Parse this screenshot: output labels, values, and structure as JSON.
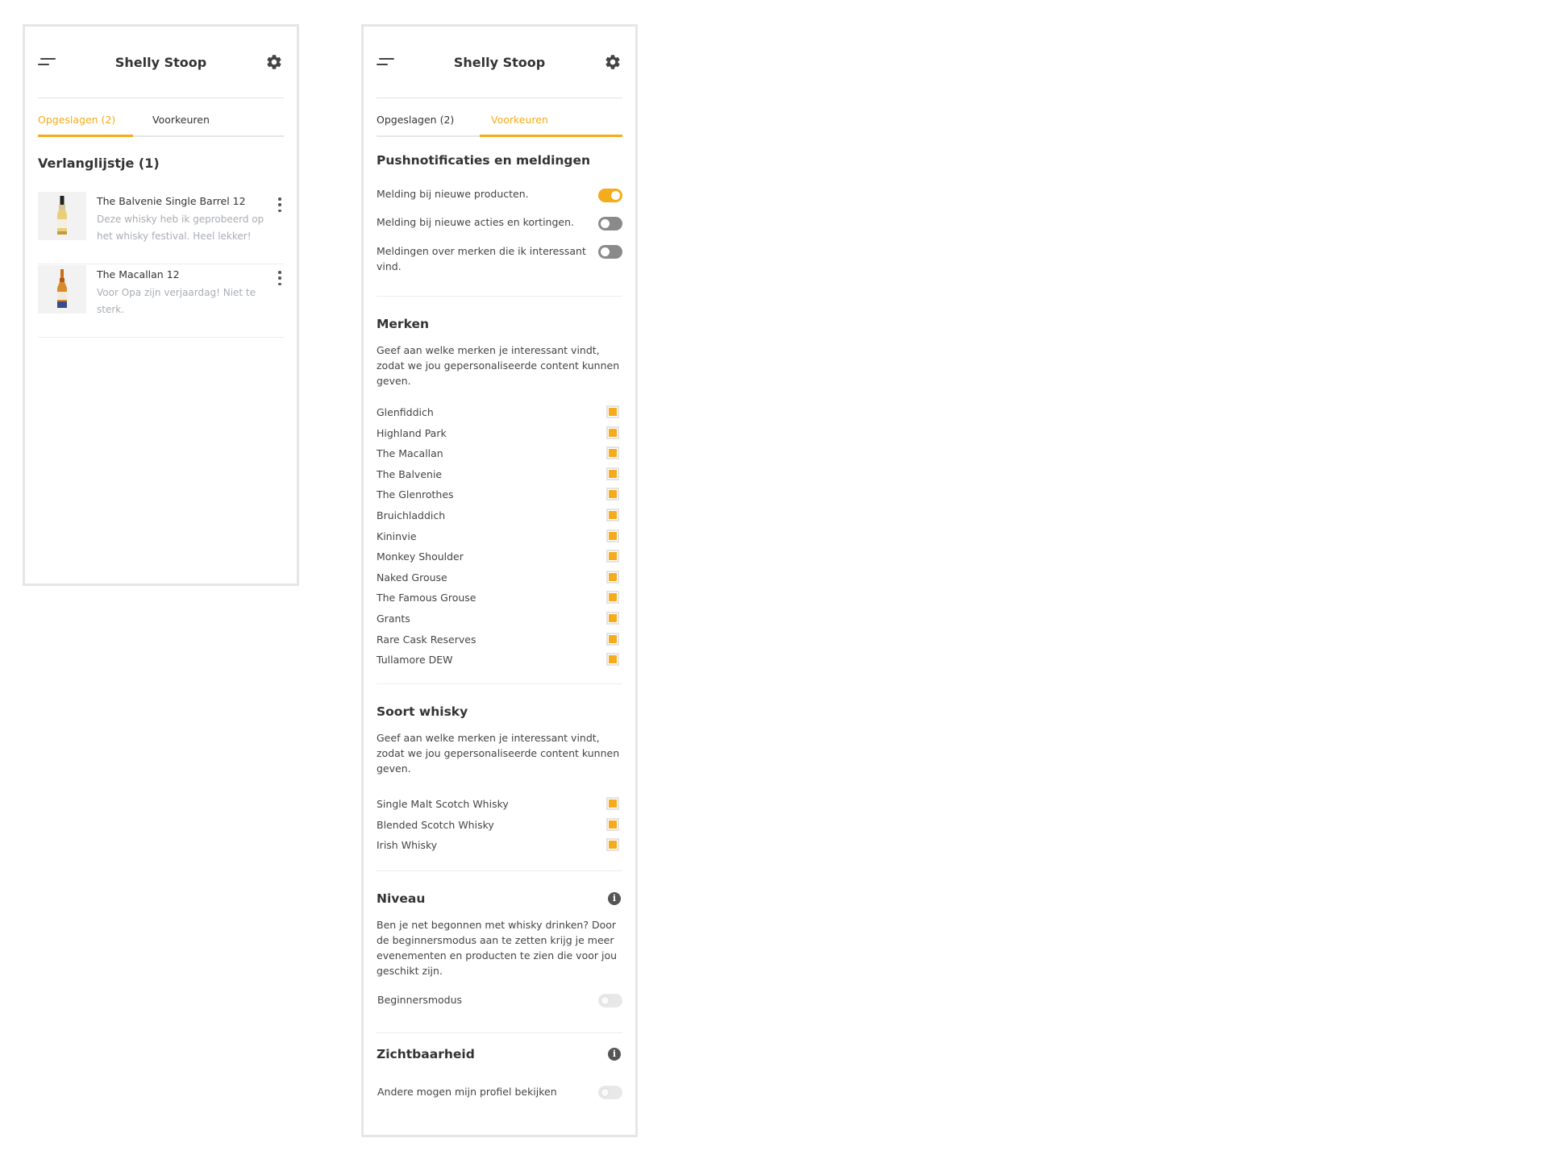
{
  "left": {
    "header": {
      "title": "Shelly Stoop",
      "menu_icon": "menu-icon",
      "settings_icon": "gear-icon"
    },
    "tabs": [
      {
        "label": "Opgeslagen (2)",
        "active": true
      },
      {
        "label": "Voorkeuren",
        "active": false
      }
    ],
    "wishlist": {
      "title": "Verlanglijstje (1)",
      "items": [
        {
          "name": "The Balvenie Single Barrel 12",
          "note": "Deze whisky heb ik geprobeerd op het whisky festival. Heel lekker!"
        },
        {
          "name": "The Macallan 12",
          "note": "Voor Opa zijn verjaardag! Niet te sterk."
        }
      ]
    }
  },
  "right": {
    "header": {
      "title": "Shelly Stoop",
      "menu_icon": "menu-icon",
      "settings_icon": "gear-icon"
    },
    "tabs": [
      {
        "label": "Opgeslagen (2)",
        "active": false
      },
      {
        "label": "Voorkeuren",
        "active": true
      }
    ],
    "notifications": {
      "title": "Pushnotificaties en meldingen",
      "rows": [
        {
          "label": "Melding bij nieuwe producten.",
          "state": "on"
        },
        {
          "label": "Melding bij nieuwe acties en kortingen.",
          "state": "off"
        },
        {
          "label": "Meldingen over merken die ik interessant vind.",
          "state": "off"
        }
      ]
    },
    "brands": {
      "title": "Merken",
      "description": "Geef aan welke merken je interessant vindt, zodat we jou gepersonaliseerde content kunnen geven.",
      "items": [
        {
          "label": "Glenfiddich",
          "checked": true
        },
        {
          "label": "Highland Park",
          "checked": true
        },
        {
          "label": "The Macallan",
          "checked": true
        },
        {
          "label": "The Balvenie",
          "checked": true
        },
        {
          "label": "The Glenrothes",
          "checked": true
        },
        {
          "label": "Bruichladdich",
          "checked": true
        },
        {
          "label": "Kininvie",
          "checked": true
        },
        {
          "label": "Monkey Shoulder",
          "checked": true
        },
        {
          "label": "Naked Grouse",
          "checked": true
        },
        {
          "label": "The Famous Grouse",
          "checked": true
        },
        {
          "label": "Grants",
          "checked": true
        },
        {
          "label": "Rare Cask Reserves",
          "checked": true
        },
        {
          "label": "Tullamore DEW",
          "checked": true
        }
      ]
    },
    "types": {
      "title": "Soort whisky",
      "description": "Geef aan welke merken je interessant vindt, zodat we jou gepersonaliseerde content kunnen geven.",
      "items": [
        {
          "label": "Single Malt Scotch Whisky",
          "checked": true
        },
        {
          "label": "Blended Scotch Whisky",
          "checked": true
        },
        {
          "label": "Irish Whisky",
          "checked": true
        }
      ]
    },
    "level": {
      "title": "Niveau",
      "description": "Ben je net begonnen met whisky drinken? Door de beginnersmodus aan te zetten krijg je meer evenementen en producten te zien die voor jou geschikt zijn.",
      "row": {
        "label": "Beginnersmodus",
        "state": "disabled"
      }
    },
    "visibility": {
      "title": "Zichtbaarheid",
      "row": {
        "label": "Andere mogen mijn profiel bekijken",
        "state": "disabled"
      }
    }
  },
  "colors": {
    "accent": "#f5ab1b",
    "text": "#333333",
    "muted": "#a9adb3"
  }
}
